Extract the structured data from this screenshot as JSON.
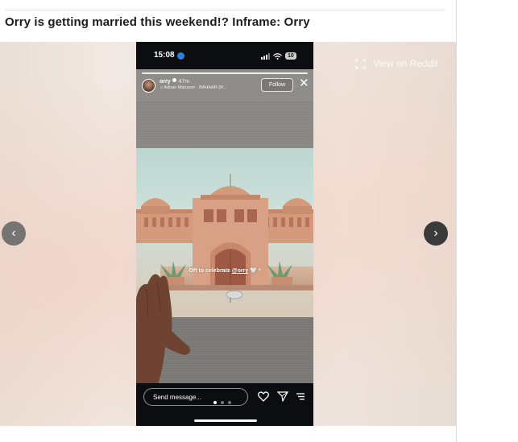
{
  "post": {
    "title": "Orry is getting married this weekend!? Inframe: Orry"
  },
  "gallery": {
    "view_on_label": "View on Reddit",
    "prev_icon": "chevron-left-icon",
    "next_icon": "chevron-right-icon",
    "page_count": 3,
    "current_page": 1
  },
  "phone": {
    "status_time": "15:08",
    "battery_level": "10"
  },
  "story": {
    "username": "orry",
    "time_ago": "47m",
    "music": "Adnan Manzoor · BAHAAR (R...",
    "follow_label": "Follow",
    "caption_text": "Off to celebrate",
    "caption_mention": "@orry",
    "caption_emoji": "🤍 *"
  },
  "reply": {
    "placeholder": "Send message..."
  },
  "colors": {
    "status_accent": "#2b7fe0",
    "phone_background": "#0b0d10",
    "palace_sandstone": "#d49a7c",
    "sky": "#bcd6cf"
  }
}
